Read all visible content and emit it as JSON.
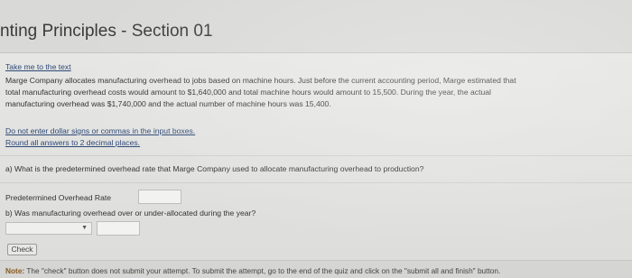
{
  "page_title": "nting Principles - Section 01",
  "take_me_link": "Take me to the text",
  "problem_lines": [
    "Marge Company allocates manufacturing overhead to jobs based on machine hours. Just before the current accounting period, Marge estimated that",
    "total manufacturing overhead costs would amount to $1,640,000 and total machine hours would amount to 15,500. During the year, the actual",
    "manufacturing overhead was $1,740,000 and the actual number of machine hours was 15,400."
  ],
  "instructions": [
    "Do not enter dollar signs or commas in the input boxes.",
    "Round all answers to 2 decimal places."
  ],
  "question_a": "a) What is the predetermined overhead rate that Marge Company used to allocate manufacturing overhead to production?",
  "rate_label": "Predetermined Overhead Rate",
  "rate_value": "",
  "question_b": "b) Was manufacturing overhead over or under-allocated during the year?",
  "allocation_select_value": "",
  "allocation_amount_value": "",
  "check_button": "Check",
  "note_label": "Note:",
  "note_text": " The \"check\" button does not submit your attempt. To submit the attempt, go to the end of the quiz and click on the \"submit all and finish\" button."
}
